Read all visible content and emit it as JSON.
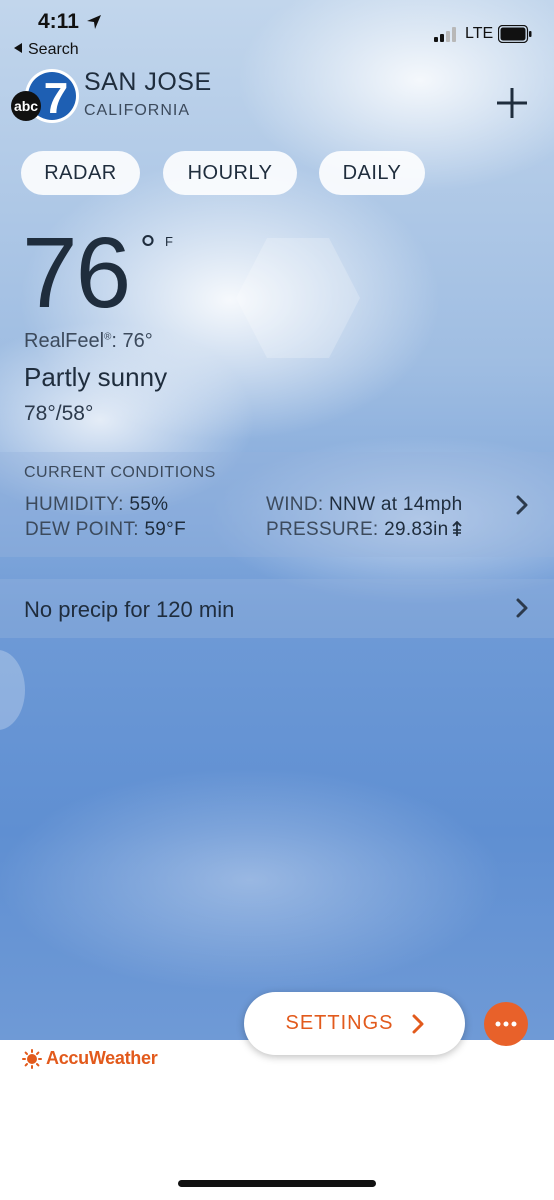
{
  "status_bar": {
    "time": "4:11",
    "back_label": "Search",
    "network": "LTE"
  },
  "header": {
    "logo_text": "abc",
    "logo_number": "7",
    "city": "SAN JOSE",
    "state": "CALIFORNIA"
  },
  "tabs": [
    {
      "label": "RADAR"
    },
    {
      "label": "HOURLY"
    },
    {
      "label": "DAILY"
    }
  ],
  "current": {
    "temperature": "76",
    "degree": "°",
    "unit": "F",
    "realfeel_label": "RealFeel",
    "realfeel_mark": "®",
    "realfeel_value": ": 76°",
    "description": "Partly sunny",
    "hi_lo": "78°/58°"
  },
  "conditions": {
    "title": "CURRENT CONDITIONS",
    "humidity_label": "HUMIDITY:",
    "humidity_value": "55%",
    "dew_point_label": "DEW POINT:",
    "dew_point_value": "59°F",
    "wind_label": "WIND:",
    "wind_value": "NNW at 14mph",
    "pressure_label": "PRESSURE:",
    "pressure_value": "29.83in"
  },
  "precip": {
    "text": "No precip for 120 min"
  },
  "footer": {
    "brand": "AccuWeather",
    "settings_label": "SETTINGS"
  },
  "colors": {
    "accent": "#e25a1c",
    "text": "#1f2d3d",
    "sky_top": "#c2d6ec",
    "sky_bottom": "#5f8fd2"
  },
  "icons": [
    "location-arrow-icon",
    "back-triangle-icon",
    "signal-icon",
    "battery-icon",
    "plus-icon",
    "chevron-right-icon",
    "pressure-rising-icon",
    "sun-icon",
    "more-icon"
  ]
}
